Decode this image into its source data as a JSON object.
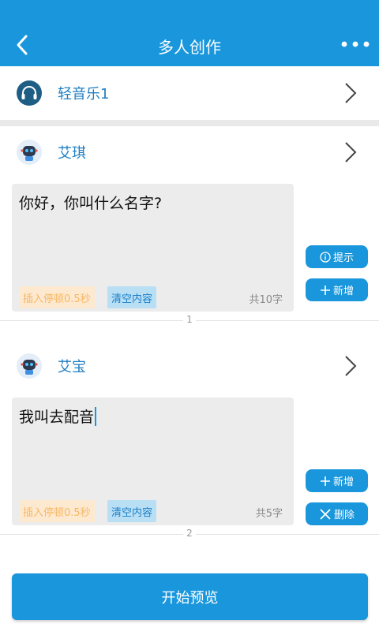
{
  "header": {
    "title": "多人创作",
    "back_icon": "chevron-left-icon",
    "more_icon": "more-dots-icon",
    "color": "#1a97dc"
  },
  "music": {
    "label": "轻音乐1",
    "icon": "headphones-icon"
  },
  "segments": [
    {
      "speaker": "艾琪",
      "text": "你好，你叫什么名字?",
      "pause_label": "插入停顿0.5秒",
      "clear_label": "清空内容",
      "count": "共10字",
      "index": "1"
    },
    {
      "speaker": "艾宝",
      "text": "我叫去配音",
      "pause_label": "插入停顿0.5秒",
      "clear_label": "清空内容",
      "count": "共5字",
      "index": "2"
    }
  ],
  "actions": {
    "hint": "提示",
    "add": "新增",
    "delete": "删除"
  },
  "start_button": "开始预览"
}
